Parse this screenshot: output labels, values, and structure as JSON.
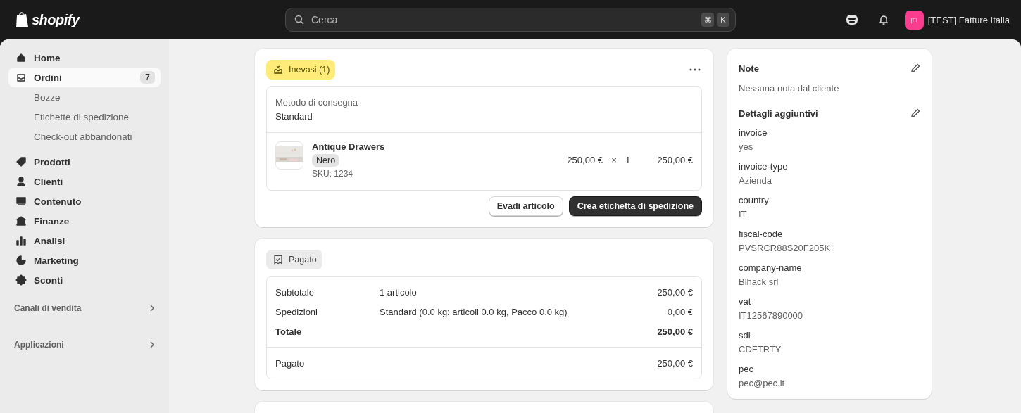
{
  "topbar": {
    "logo": "shopify",
    "search": {
      "placeholder": "Cerca",
      "keys": [
        "⌘",
        "K"
      ]
    },
    "store": {
      "avatar": "[FI",
      "name": "[TEST] Fatture Italia"
    }
  },
  "sidebar": {
    "items": [
      {
        "kind": "main",
        "label": "Home",
        "selected": false
      },
      {
        "kind": "main",
        "label": "Ordini",
        "selected": true,
        "badge": "7"
      },
      {
        "kind": "sub",
        "label": "Bozze",
        "selected": false
      },
      {
        "kind": "sub",
        "label": "Etichette di spedizione",
        "selected": false
      },
      {
        "kind": "sub",
        "label": "Check-out abbandonati",
        "selected": false
      },
      {
        "kind": "main",
        "label": "Prodotti",
        "selected": false
      },
      {
        "kind": "main",
        "label": "Clienti",
        "selected": false
      },
      {
        "kind": "main",
        "label": "Contenuto",
        "selected": false
      },
      {
        "kind": "main",
        "label": "Finanze",
        "selected": false
      },
      {
        "kind": "main",
        "label": "Analisi",
        "selected": false
      },
      {
        "kind": "main",
        "label": "Marketing",
        "selected": false
      },
      {
        "kind": "main",
        "label": "Sconti",
        "selected": false
      },
      {
        "kind": "section",
        "label": "Canali di vendita",
        "selected": false
      },
      {
        "kind": "section",
        "label": "Applicazioni",
        "selected": false
      }
    ]
  },
  "fulfillment": {
    "status": "Inevasi (1)",
    "delivery_label": "Metodo di consegna",
    "delivery_value": "Standard",
    "line_item": {
      "kind": "picture",
      "name": "Antique Drawers",
      "variant": "Nero",
      "sku": "SKU: 1234",
      "price": "250,00 €",
      "times": "×",
      "quantity": "1",
      "total": "250,00 €"
    },
    "buttons": [
      "Evadi articolo",
      "Crea etichetta di spedizione"
    ]
  },
  "payment": {
    "status": "Pagato",
    "rows": [
      {
        "label": "Subtotale",
        "detail": "1 articolo",
        "amount": "250,00 €",
        "bold": false
      },
      {
        "label": "Spedizioni",
        "detail": "Standard (0.0 kg: articoli 0.0 kg, Pacco 0.0 kg)",
        "amount": "0,00 €",
        "bold": false
      },
      {
        "label": "Totale",
        "amount": "250,00 €",
        "bold": true
      }
    ],
    "paid": {
      "label": "Pagato",
      "amount": "250,00 €"
    }
  },
  "notes": {
    "title": "Note",
    "text": "Nessuna nota dal cliente",
    "details_title": "Dettagli aggiuntivi",
    "details": [
      {
        "key": "invoice",
        "value": "yes"
      },
      {
        "key": "invoice-type",
        "value": "Azienda"
      },
      {
        "key": "country",
        "value": "IT"
      },
      {
        "key": "fiscal-code",
        "value": "PVSRCR88S20F205K"
      },
      {
        "key": "company-name",
        "value": "Blhack srl"
      },
      {
        "key": "vat",
        "value": "IT12567890000"
      },
      {
        "key": "sdi",
        "value": "CDFTRTY"
      },
      {
        "key": "pec",
        "value": "pec@pec.it"
      }
    ]
  }
}
